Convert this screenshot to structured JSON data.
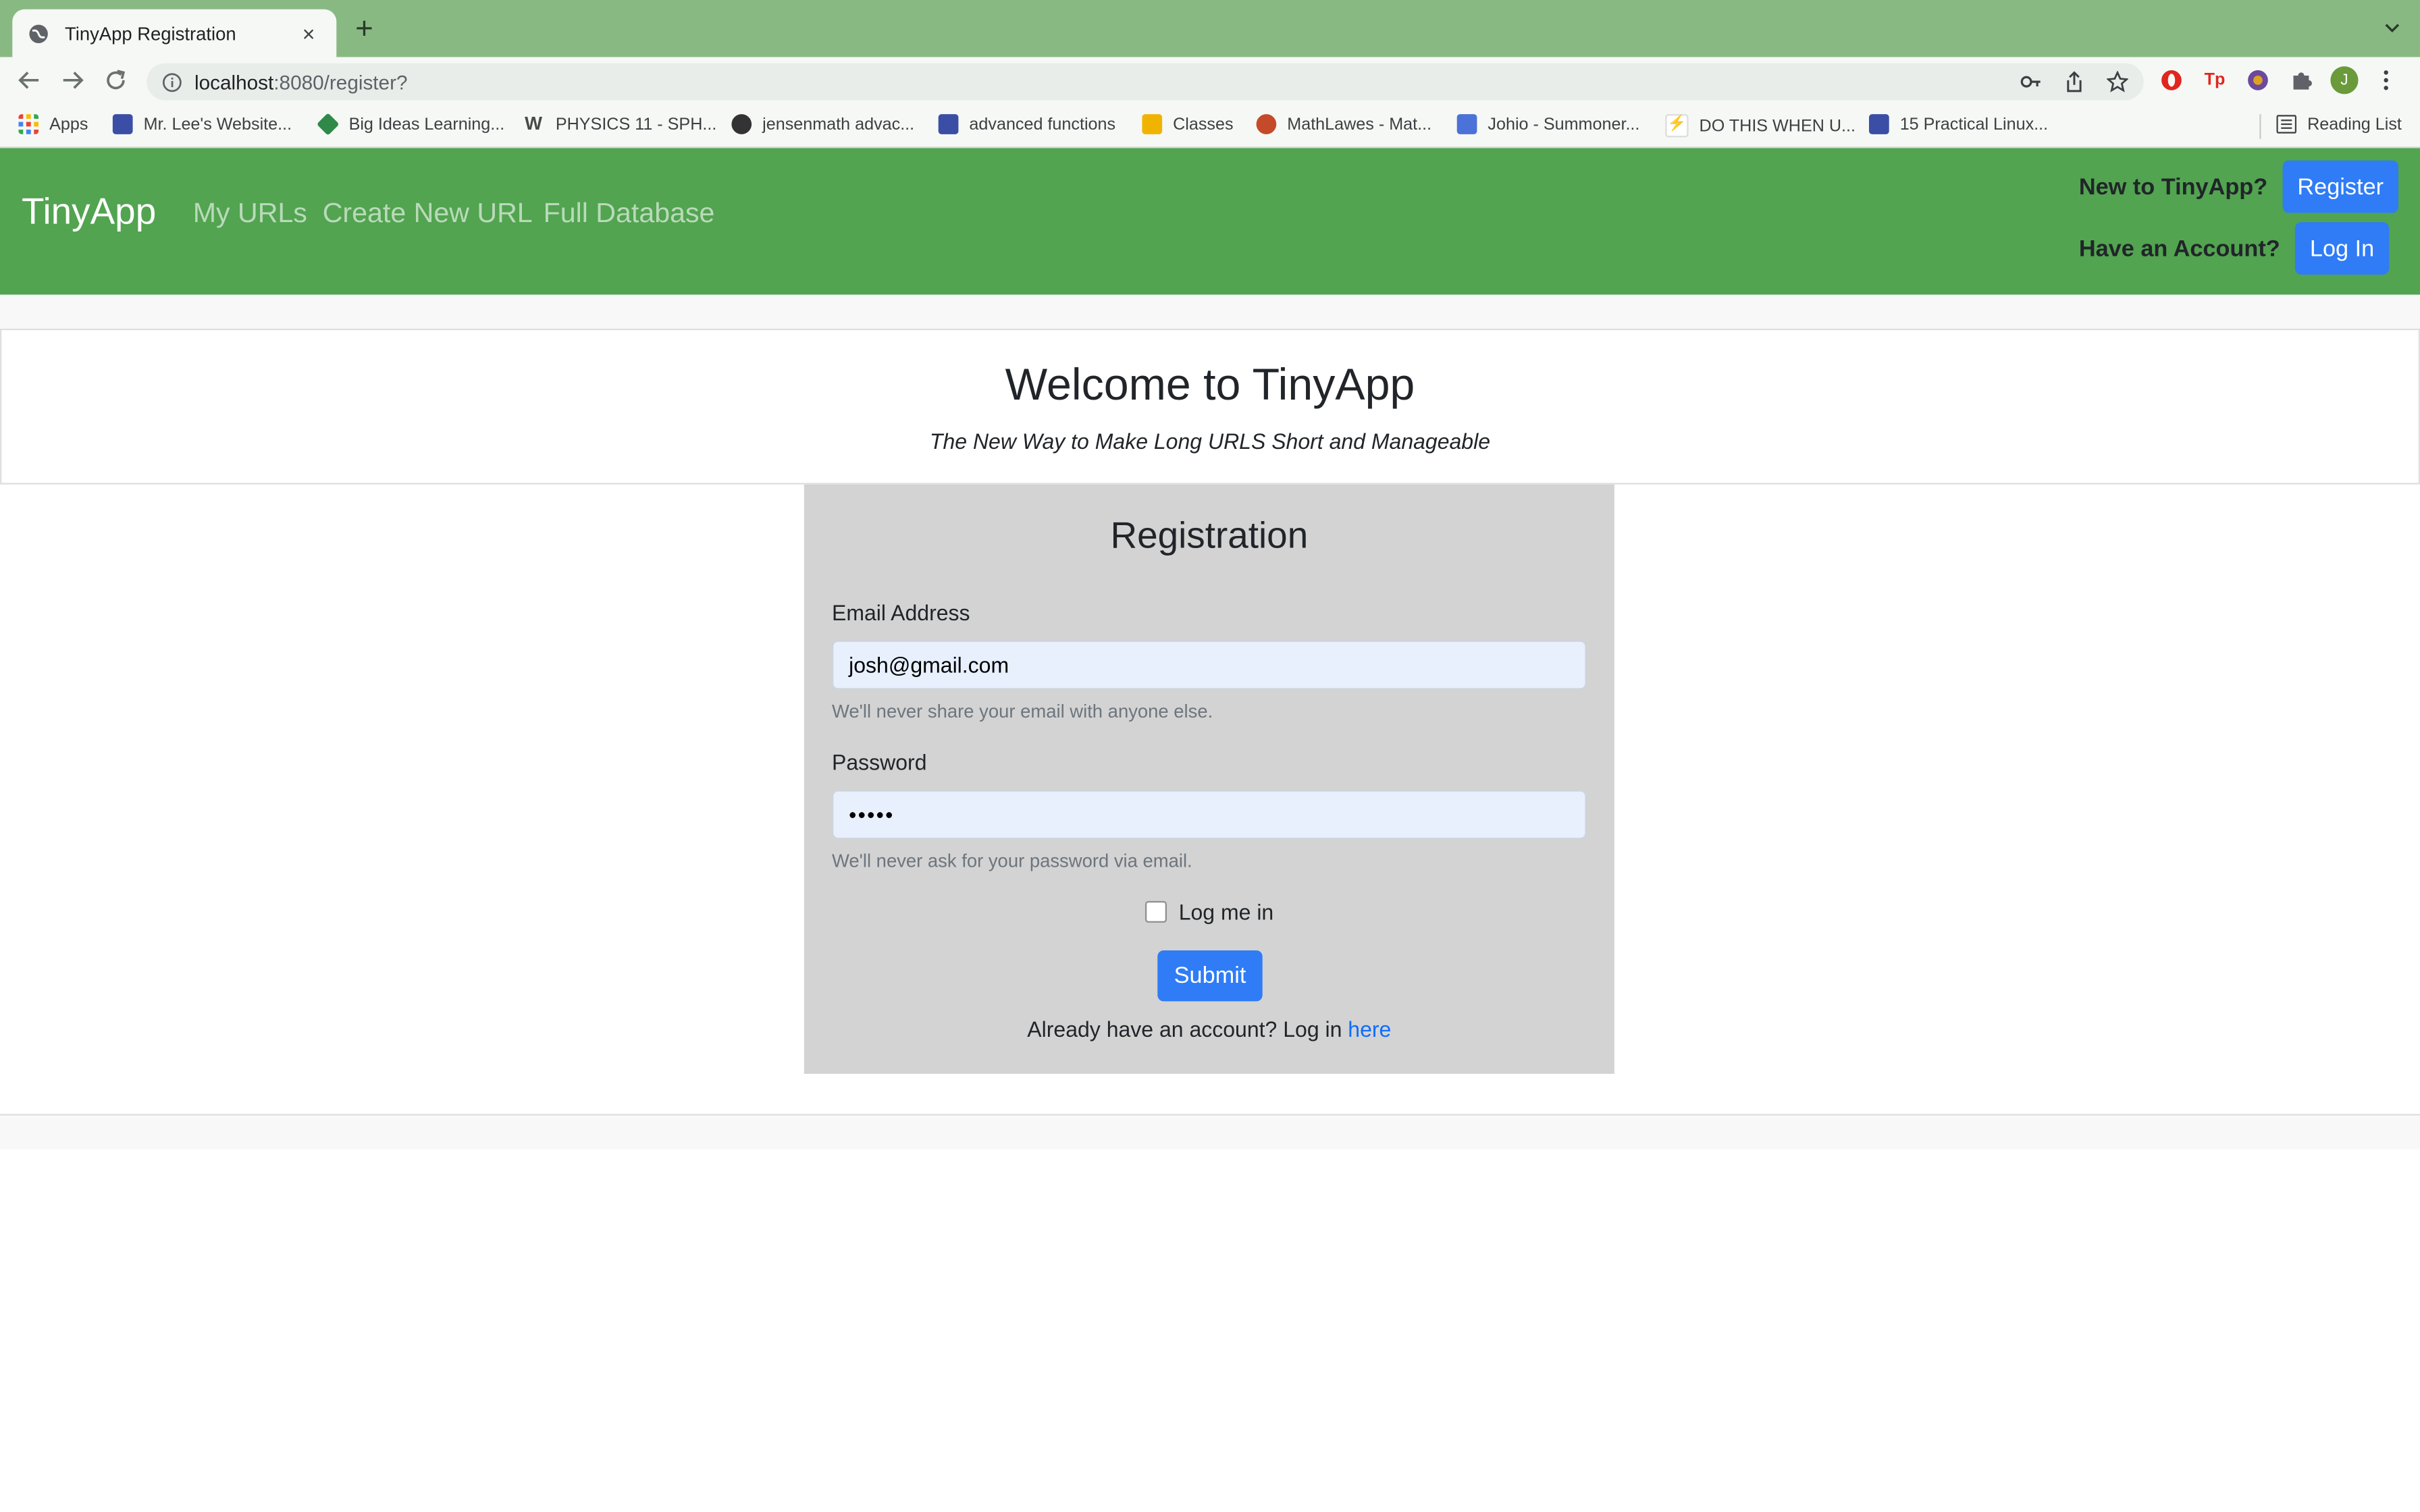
{
  "browser": {
    "tab_title": "TinyApp Registration",
    "tab_close": "×",
    "new_tab": "+",
    "url_host": "localhost",
    "url_path": ":8080/register?",
    "bookmarks": [
      {
        "label": "Apps",
        "color": "#ea4335"
      },
      {
        "label": "Mr. Lee's Website...",
        "color": "#3b4ea6"
      },
      {
        "label": "Big Ideas Learning...",
        "color": "#2f8a4a"
      },
      {
        "label": "PHYSICS 11 - SPH...",
        "color": "#4a4a4a"
      },
      {
        "label": "jensenmath advac...",
        "color": "#333333"
      },
      {
        "label": "advanced functions",
        "color": "#3b4ea6"
      },
      {
        "label": "Classes",
        "color": "#f0b400"
      },
      {
        "label": "MathLawes - Mat...",
        "color": "#c44a2a"
      },
      {
        "label": "Johio - Summoner...",
        "color": "#4a72d8"
      },
      {
        "label": "DO THIS WHEN U...",
        "color": "#e33b3b"
      },
      {
        "label": "15 Practical Linux...",
        "color": "#3b4ea6"
      }
    ],
    "reading_list": "Reading List",
    "avatar_letter": "J"
  },
  "navbar": {
    "brand": "TinyApp",
    "links": [
      "My URLs",
      "Create New URL",
      "Full Database"
    ],
    "new_prompt": "New to TinyApp?",
    "register_label": "Register",
    "have_prompt": "Have an Account?",
    "login_label": "Log In"
  },
  "jumbotron": {
    "title": "Welcome to TinyApp",
    "subtitle": "The New Way to Make Long URLS Short and Manageable"
  },
  "form": {
    "heading": "Registration",
    "email_label": "Email Address",
    "email_value": "josh@gmail.com",
    "email_help": "We'll never share your email with anyone else.",
    "password_label": "Password",
    "password_value": "•••••",
    "password_help": "We'll never ask for your password via email.",
    "remember_label": "Log me in",
    "submit_label": "Submit",
    "already_text": "Already have an account? Log in ",
    "here_link": "here"
  },
  "colors": {
    "navbar": "#52a450",
    "button": "#2f7cf6",
    "card": "#d3d3d3"
  }
}
